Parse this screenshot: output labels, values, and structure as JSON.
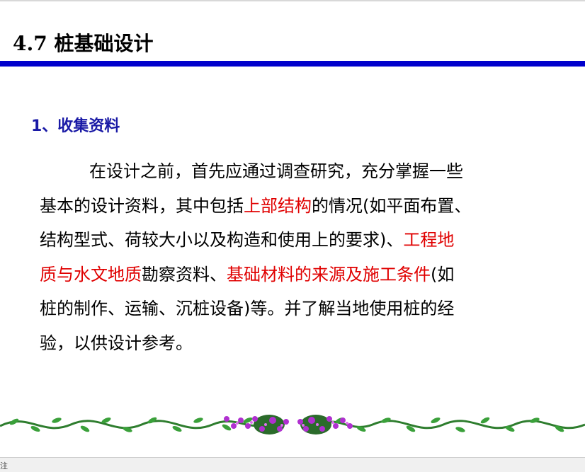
{
  "slide": {
    "title": "4.7 桩基础设计",
    "section_heading": "1、收集资料",
    "paragraph": {
      "line1": "在设计之前，首先应通过调查研究，充分掌握一些",
      "line2_a": "基本的设计资料，其中包括",
      "line2_b_red": "上部结构",
      "line2_c": "的情况(如平面布置、",
      "line3_a": "结构型式、荷较大小以及构造和使用上的要求)、",
      "line3_b_red": "工程地",
      "line4_a_red": "质与水文地质",
      "line4_b": "勘察资料、",
      "line4_c_red": "基础材料的来源及施工条件",
      "line4_d": "(如",
      "line5": "桩的制作、运输、沉桩设备)等。并了解当地使用桩的经",
      "line6": "验，以供设计参考。"
    }
  },
  "status_bar": {
    "notes_label": "注"
  },
  "colors": {
    "title_rule": "#0000cc",
    "heading": "#1a1aa6",
    "highlight": "#e00000",
    "vine": "#2e8b2e",
    "flowers": "#a020c0"
  },
  "icons": {
    "border": "flower-vine-border"
  }
}
